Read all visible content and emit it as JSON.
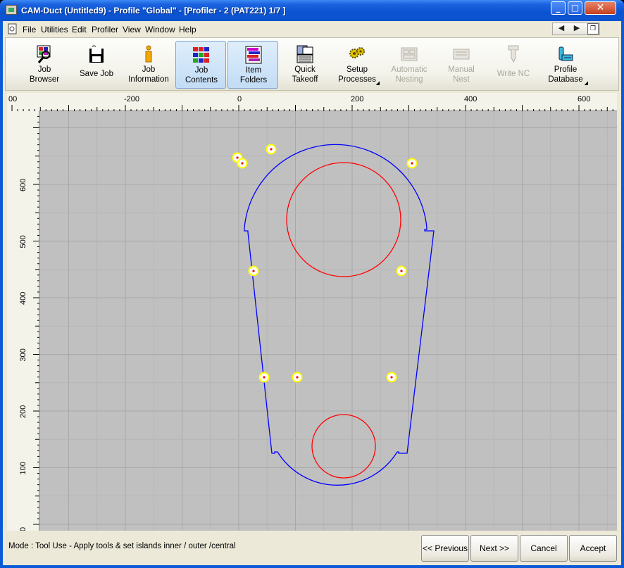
{
  "window": {
    "title": "CAM-Duct (Untitled9) - Profile \"Global\" - [Profiler - 2 (PAT221) 1/7  ]",
    "minimize": "_",
    "maximize": "□",
    "close": "✕"
  },
  "menu": {
    "items": [
      "File",
      "Utilities",
      "Edit",
      "Profiler",
      "View",
      "Window",
      "Help"
    ],
    "nav_back": "◀",
    "nav_forward": "▶",
    "restore": "❐"
  },
  "toolbar": {
    "tools": [
      {
        "label_line1": "Job",
        "label_line2": "Browser",
        "icon": "job-browser-icon",
        "enabled": true
      },
      {
        "label_line1": "Save Job",
        "label_line2": "",
        "icon": "save-icon",
        "enabled": true
      },
      {
        "label_line1": "Job",
        "label_line2": "Information",
        "icon": "info-icon",
        "enabled": true
      },
      {
        "label_line1": "Job",
        "label_line2": "Contents",
        "icon": "grid-icon",
        "enabled": true,
        "active": true
      },
      {
        "label_line1": "Item",
        "label_line2": "Folders",
        "icon": "folders-icon",
        "enabled": true,
        "active": true
      },
      {
        "label_line1": "Quick",
        "label_line2": "Takeoff",
        "icon": "takeoff-icon",
        "enabled": true
      },
      {
        "label_line1": "Setup",
        "label_line2": "Processes",
        "icon": "gears-icon",
        "enabled": true,
        "dropdown": true
      },
      {
        "label_line1": "Automatic",
        "label_line2": "Nesting",
        "icon": "nesting-icon",
        "enabled": false
      },
      {
        "label_line1": "Manual",
        "label_line2": "Nest",
        "icon": "manual-nest-icon",
        "enabled": false
      },
      {
        "label_line1": "Write NC",
        "label_line2": "",
        "icon": "write-nc-icon",
        "enabled": false
      },
      {
        "label_line1": "Profile",
        "label_line2": "Database",
        "icon": "database-icon",
        "enabled": true,
        "dropdown": true
      }
    ],
    "dropdown_glyph": "◢"
  },
  "ruler": {
    "x_labels": [
      "00",
      "-200",
      "0",
      "200",
      "400",
      "600"
    ],
    "y_labels": [
      "600",
      "500",
      "400",
      "300",
      "200",
      "100",
      "0"
    ]
  },
  "colors": {
    "outline": "#0000ff",
    "holes": "#ff0000",
    "markers": "#ffff00",
    "canvas": "#c0c0c0"
  },
  "status": {
    "mode": "Mode : Tool Use - Apply tools & set islands inner / outer /central",
    "previous": "<< Previous",
    "next": "Next >>",
    "cancel": "Cancel",
    "accept": "Accept"
  }
}
